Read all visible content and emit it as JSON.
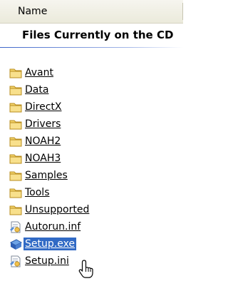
{
  "header": {
    "column_name": "Name"
  },
  "section": {
    "title": "Files Currently on the CD"
  },
  "files": [
    {
      "name": "Avant",
      "type": "folder",
      "icon": "folder-icon"
    },
    {
      "name": "Data",
      "type": "folder",
      "icon": "folder-icon"
    },
    {
      "name": "DirectX",
      "type": "folder",
      "icon": "folder-icon"
    },
    {
      "name": "Drivers",
      "type": "folder",
      "icon": "folder-icon"
    },
    {
      "name": "NOAH2",
      "type": "folder",
      "icon": "folder-icon"
    },
    {
      "name": "NOAH3",
      "type": "folder",
      "icon": "folder-icon"
    },
    {
      "name": "Samples",
      "type": "folder",
      "icon": "folder-icon"
    },
    {
      "name": "Tools",
      "type": "folder",
      "icon": "folder-icon"
    },
    {
      "name": "Unsupported",
      "type": "folder",
      "icon": "folder-icon"
    },
    {
      "name": "Autorun.inf",
      "type": "inf",
      "icon": "setup-info-icon"
    },
    {
      "name": "Setup.exe",
      "type": "exe",
      "icon": "setup-exe-icon",
      "selected": true
    },
    {
      "name": "Setup.ini",
      "type": "ini",
      "icon": "setup-info-icon"
    }
  ],
  "colors": {
    "selection": "#316ac5",
    "folder": "#f3d46b",
    "header_bg": "#ebeadb",
    "rule": "#3d65c9"
  }
}
